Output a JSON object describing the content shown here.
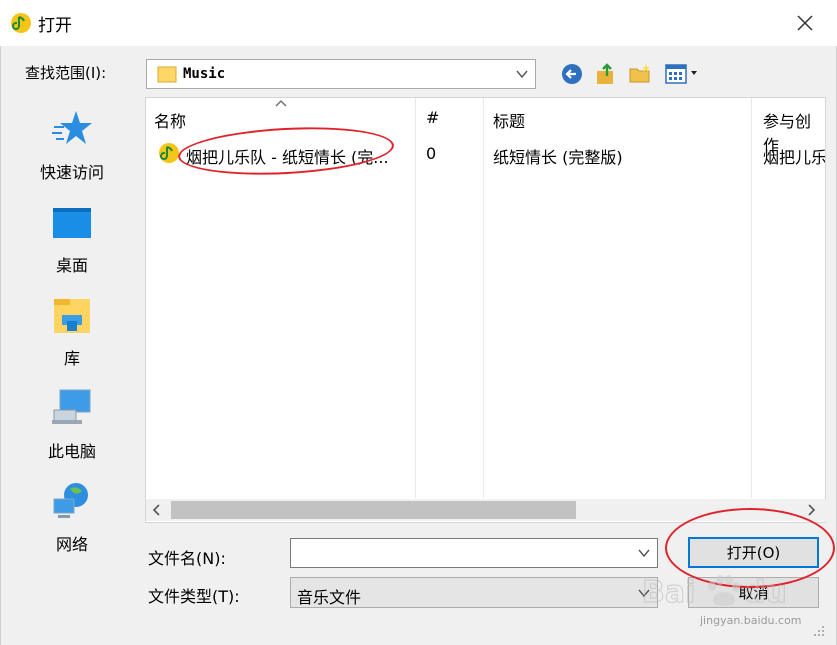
{
  "window": {
    "title": "打开",
    "app_icon": "qq-music-icon",
    "close_icon": "close-icon"
  },
  "toolbar": {
    "look_in_label": "查找范围(I):",
    "look_in_value": "Music",
    "back_icon": "back-arrow-icon",
    "up_icon": "up-folder-icon",
    "new_folder_icon": "new-folder-icon",
    "view_menu_icon": "view-menu-icon"
  },
  "places": [
    {
      "label": "快速访问",
      "icon": "star-icon"
    },
    {
      "label": "桌面",
      "icon": "desktop-icon"
    },
    {
      "label": "库",
      "icon": "library-icon"
    },
    {
      "label": "此电脑",
      "icon": "computer-icon"
    },
    {
      "label": "网络",
      "icon": "network-icon"
    }
  ],
  "file_list": {
    "columns": [
      "名称",
      "#",
      "标题",
      "参与创作"
    ],
    "rows": [
      {
        "name": "烟把儿乐队 - 纸短情长 (完...",
        "number": "0",
        "title": "纸短情长 (完整版)",
        "artist": "烟把儿乐"
      }
    ]
  },
  "form": {
    "file_name_label": "文件名(N):",
    "file_name_value": "",
    "file_type_label": "文件类型(T):",
    "file_type_value": "音乐文件"
  },
  "buttons": {
    "open": "打开(O)",
    "cancel": "取消"
  },
  "watermark": {
    "brand": "Bai du",
    "sub": "jingyan.baidu.com"
  },
  "colors": {
    "accent": "#0078d7",
    "annotation": "#e0232b",
    "dialog_bg": "#f0f0f0"
  }
}
